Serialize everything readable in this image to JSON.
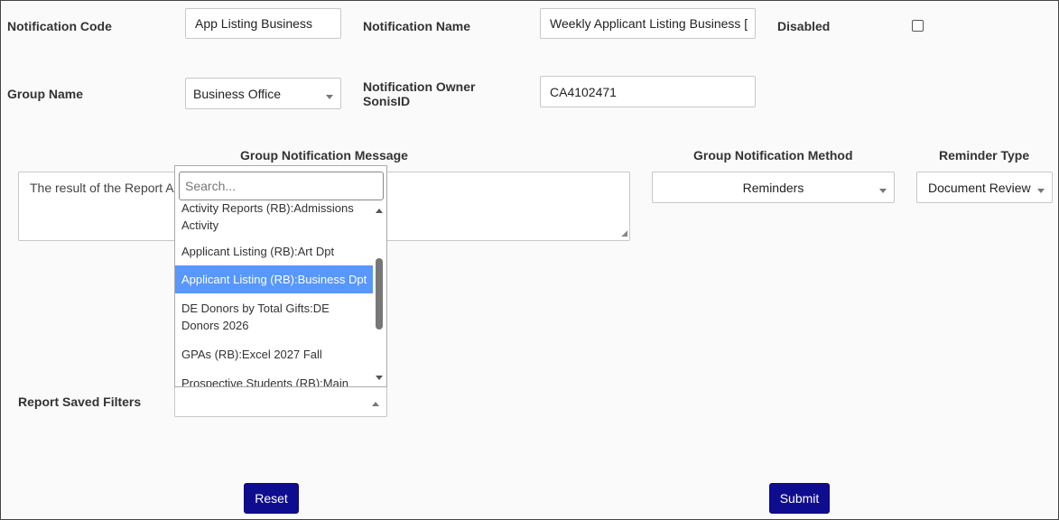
{
  "form": {
    "notification_code_label": "Notification Code",
    "notification_code_value": "App Listing Business",
    "notification_name_label": "Notification Name",
    "notification_name_value": "Weekly Applicant Listing Business [",
    "disabled_label": "Disabled",
    "disabled_checked": false,
    "group_name_label": "Group Name",
    "group_name_value": "Business Office",
    "owner_label_line1": "Notification Owner",
    "owner_label_line2": "SonisID",
    "owner_value": "CA4102471"
  },
  "sections": {
    "group_message_header": "Group Notification Message",
    "group_message_text": "The result of the Report A",
    "group_method_header": "Group Notification Method",
    "group_method_value": "Reminders",
    "reminder_type_header": "Reminder Type",
    "reminder_type_value": "Document Review"
  },
  "report_filters": {
    "label": "Report Saved Filters",
    "dropdown": {
      "search_placeholder": "Search...",
      "items": [
        {
          "line1": "Activity Reports (RB):Admissions",
          "line2": "Activity",
          "selected": false
        },
        {
          "line1": "Applicant Listing (RB):Art Dpt",
          "line2": "",
          "selected": false
        },
        {
          "line1": "Applicant Listing (RB):Business Dpt",
          "line2": "",
          "selected": true
        },
        {
          "line1": "DE Donors by Total Gifts:DE",
          "line2": "Donors 2026",
          "selected": false
        },
        {
          "line1": "GPAs (RB):Excel 2027 Fall",
          "line2": "",
          "selected": false
        },
        {
          "line1": "Prospective Students (RB):Main",
          "line2": "",
          "selected": false
        }
      ]
    }
  },
  "buttons": {
    "reset": "Reset",
    "submit": "Submit"
  },
  "colors": {
    "button_bg": "#0f0d8f",
    "selected_item_bg": "#5897fb"
  }
}
